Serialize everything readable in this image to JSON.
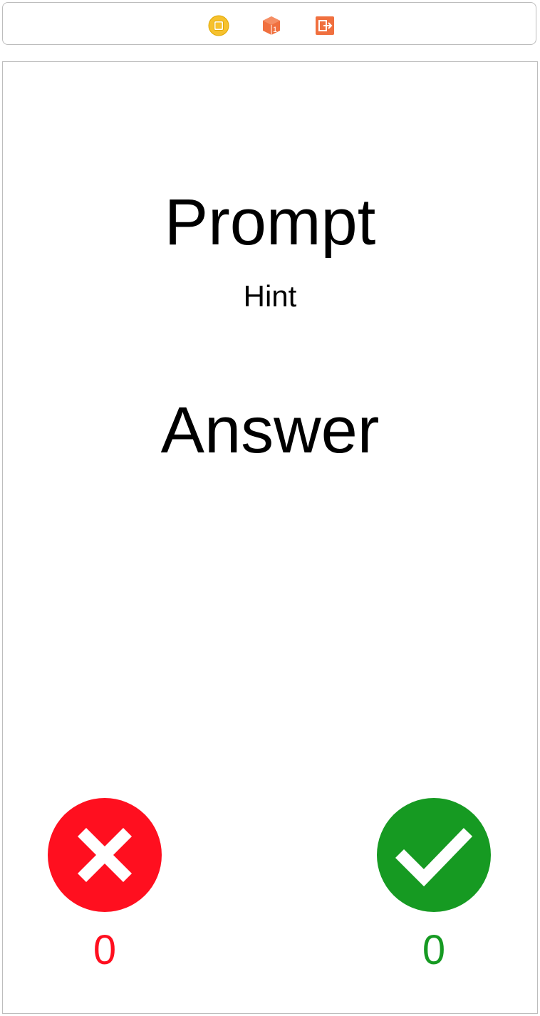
{
  "dock": {
    "icons": [
      "view-controller-icon",
      "first-responder-icon",
      "exit-icon"
    ]
  },
  "card": {
    "prompt": "Prompt",
    "hint": "Hint",
    "answer": "Answer"
  },
  "wrong": {
    "icon": "x-icon",
    "count": "0",
    "color": "#FF0F1F"
  },
  "correct": {
    "icon": "checkmark-icon",
    "count": "0",
    "color": "#169A22"
  }
}
